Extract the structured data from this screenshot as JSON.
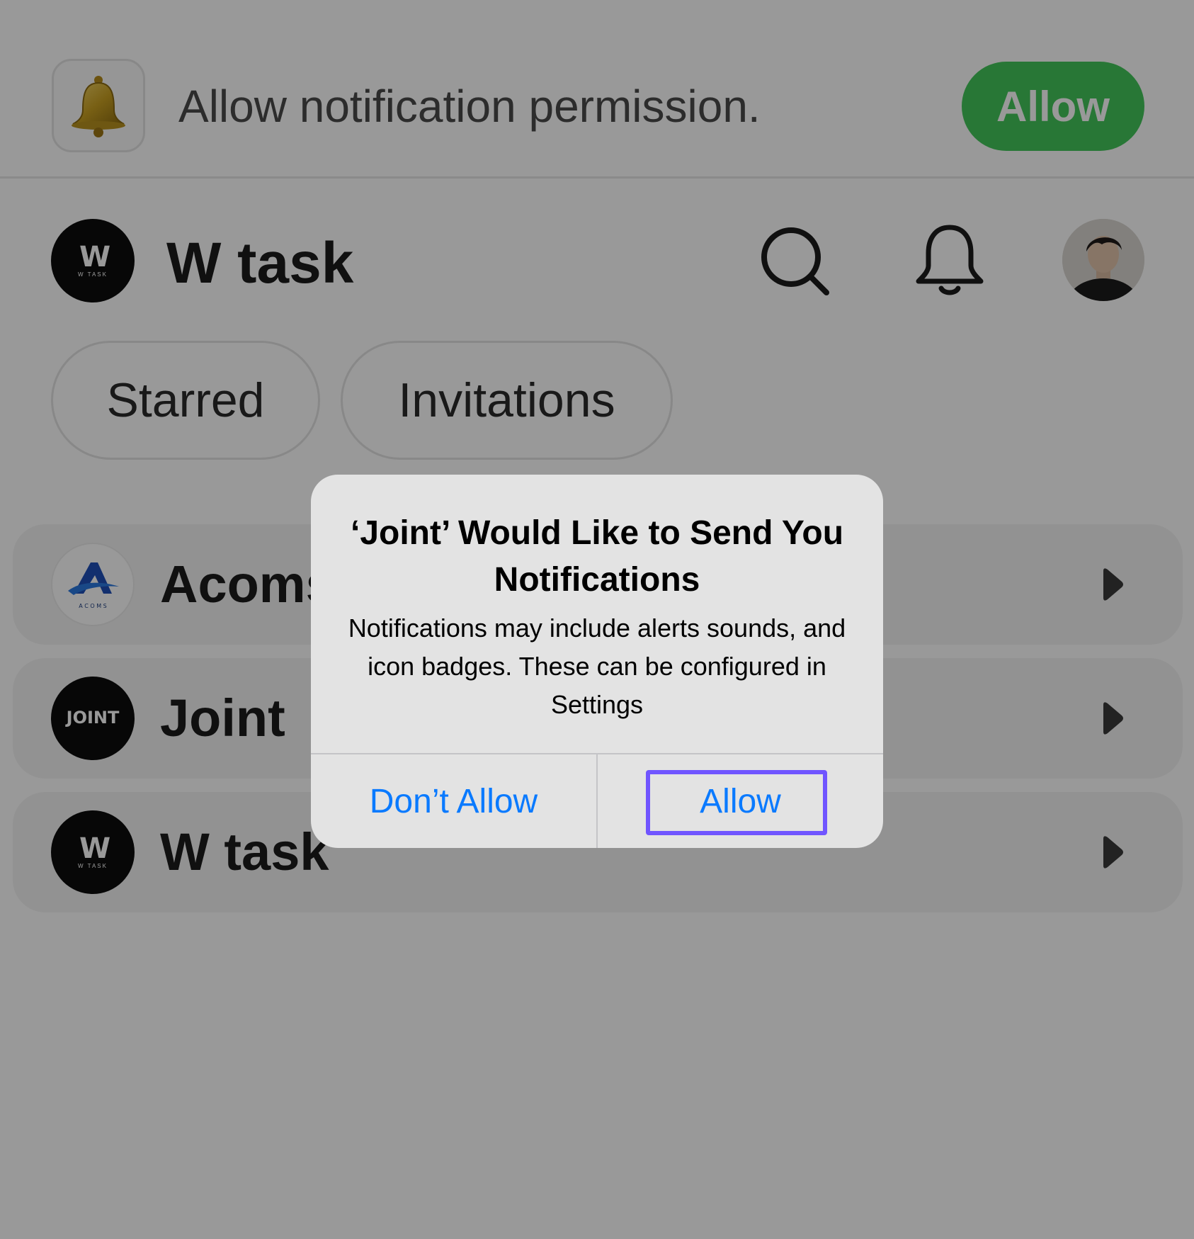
{
  "banner": {
    "message": "Allow notification permission.",
    "allow_label": "Allow",
    "icon": "bell-emoji-icon"
  },
  "header": {
    "logo_letter": "W",
    "logo_subtext": "W TASK",
    "title": "W task",
    "icons": [
      "search-icon",
      "bell-icon"
    ],
    "avatar": "profile-photo"
  },
  "tabs": [
    {
      "label": "Starred"
    },
    {
      "label": "Invitations"
    }
  ],
  "workspaces": [
    {
      "name": "Acoms",
      "logo_text": "A C O M S"
    },
    {
      "name": "Joint",
      "logo_text": "JOINT"
    },
    {
      "name": "W task",
      "logo_text": "W TASK"
    }
  ],
  "alert": {
    "title": "‘Joint’ Would Like to Send You Notifications",
    "message": "Notifications may include alerts sounds, and icon badges. These can be configured in Settings",
    "deny_label": "Don’t Allow",
    "allow_label": "Allow"
  },
  "colors": {
    "banner_allow": "#43c65a",
    "alert_button_text": "#0a7aff",
    "highlight": "#7055ff",
    "overlay": "rgba(0,0,0,0.4)"
  }
}
